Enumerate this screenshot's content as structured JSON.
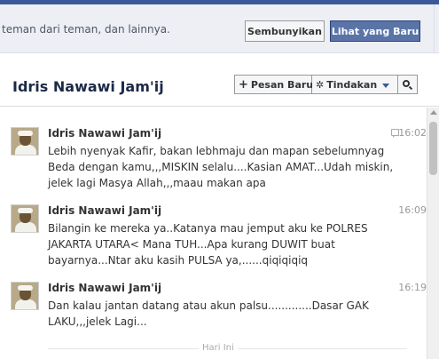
{
  "notice": {
    "text": "teman dari teman, dan lainnya.",
    "hide_button": "Sembunyikan",
    "show_new_button": "Lihat yang Baru"
  },
  "conversation": {
    "title": "Idris Nawawi Jam'ij",
    "toolbar": {
      "new_message": "Pesan Baru",
      "actions": "Tindakan"
    }
  },
  "messages": [
    {
      "sender": "Idris Nawawi Jam'ij",
      "time": "16:02",
      "lines": [
        "Lebih nyenyak Kafir, bakan lebhmaju dan mapan sebelumnyag",
        "Beda dengan kamu,,,MISKIN selalu....Kasian AMAT...Udah miskin,",
        "jelek lagi Masya Allah,,,maau makan apa"
      ]
    },
    {
      "sender": "Idris Nawawi Jam'ij",
      "time": "16:09",
      "lines": [
        "Bilangin ke mereka ya..Katanya mau jemput aku ke POLRES",
        "JAKARTA UTARA< Mana TUH...Apa kurang DUWIT buat",
        "bayarnya...Ntar aku kasih PULSA ya,......qiqiqiqiq"
      ]
    },
    {
      "sender": "Idris Nawawi Jam'ij",
      "time": "16:19",
      "lines": [
        "Dan kalau jantan datang atau akun palsu.............Dasar GAK",
        "LAKU,,,jelek Lagi..."
      ]
    }
  ],
  "divider_label": "Hari Ini",
  "icons": {
    "plus": "plus-icon",
    "gear": "gear-icon",
    "caret": "chevron-down-icon",
    "search": "search-icon",
    "reply": "reply-icon"
  },
  "colors": {
    "brand": "#3b5998",
    "primary_button": "#5b74a8",
    "notice_bg": "#edeff4"
  }
}
